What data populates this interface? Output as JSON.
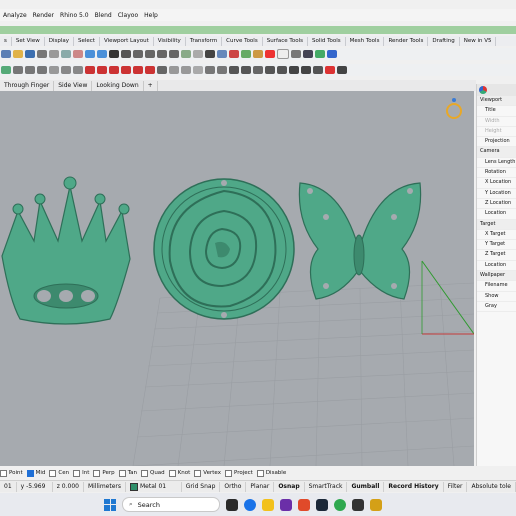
{
  "menubar": [
    "Analyze",
    "Render",
    "Rhino 5.0",
    "Blend",
    "Clayoo",
    "Help"
  ],
  "tabs": [
    "s",
    "Set View",
    "Display",
    "Select",
    "Viewport Layout",
    "Visibility",
    "Transform",
    "Curve Tools",
    "Surface Tools",
    "Solid Tools",
    "Mesh Tools",
    "Render Tools",
    "Drafting",
    "New in V5"
  ],
  "viewtabs": [
    "Through Finger",
    "Side View",
    "Looking Down"
  ],
  "viewtabs_add": "+",
  "panel": {
    "viewport_header": "Viewport",
    "title": "Title",
    "width": "Width",
    "height": "Height",
    "projection": "Projection",
    "camera_header": "Camera",
    "lens_length": "Lens Length",
    "rotation": "Rotation",
    "x_location": "X Location",
    "y_location": "Y Location",
    "z_location": "Z Location",
    "location": "Location",
    "target_header": "Target",
    "x_target": "X Target",
    "y_target": "Y Target",
    "z_target": "Z Target",
    "target_location": "Location",
    "wallpaper_header": "Wallpaper",
    "filename": "Filename",
    "show": "Show",
    "gray": "Gray"
  },
  "osnap": [
    {
      "label": "Point",
      "checked": false
    },
    {
      "label": "Mid",
      "checked": true
    },
    {
      "label": "Cen",
      "checked": false
    },
    {
      "label": "Int",
      "checked": false
    },
    {
      "label": "Perp",
      "checked": false
    },
    {
      "label": "Tan",
      "checked": false
    },
    {
      "label": "Quad",
      "checked": false
    },
    {
      "label": "Knot",
      "checked": false
    },
    {
      "label": "Vertex",
      "checked": false
    },
    {
      "label": "Project",
      "checked": false
    },
    {
      "label": "Disable",
      "checked": false
    }
  ],
  "status": {
    "x": "01",
    "y": "y -5.969",
    "z": "z 0.000",
    "units": "Millimeters",
    "layer": "Metal 01",
    "grid_snap": "Grid Snap",
    "ortho": "Ortho",
    "planar": "Planar",
    "osnap": "Osnap",
    "smarttrack": "SmartTrack",
    "gumball": "Gumball",
    "record_history": "Record History",
    "filter": "Filter",
    "tolerance": "Absolute tole"
  },
  "taskbar": {
    "search_placeholder": "Search"
  },
  "colors": {
    "model": "#4fa888",
    "viewport_bg": "#a6aaaf",
    "layer_swatch": "#2f8f6a"
  }
}
